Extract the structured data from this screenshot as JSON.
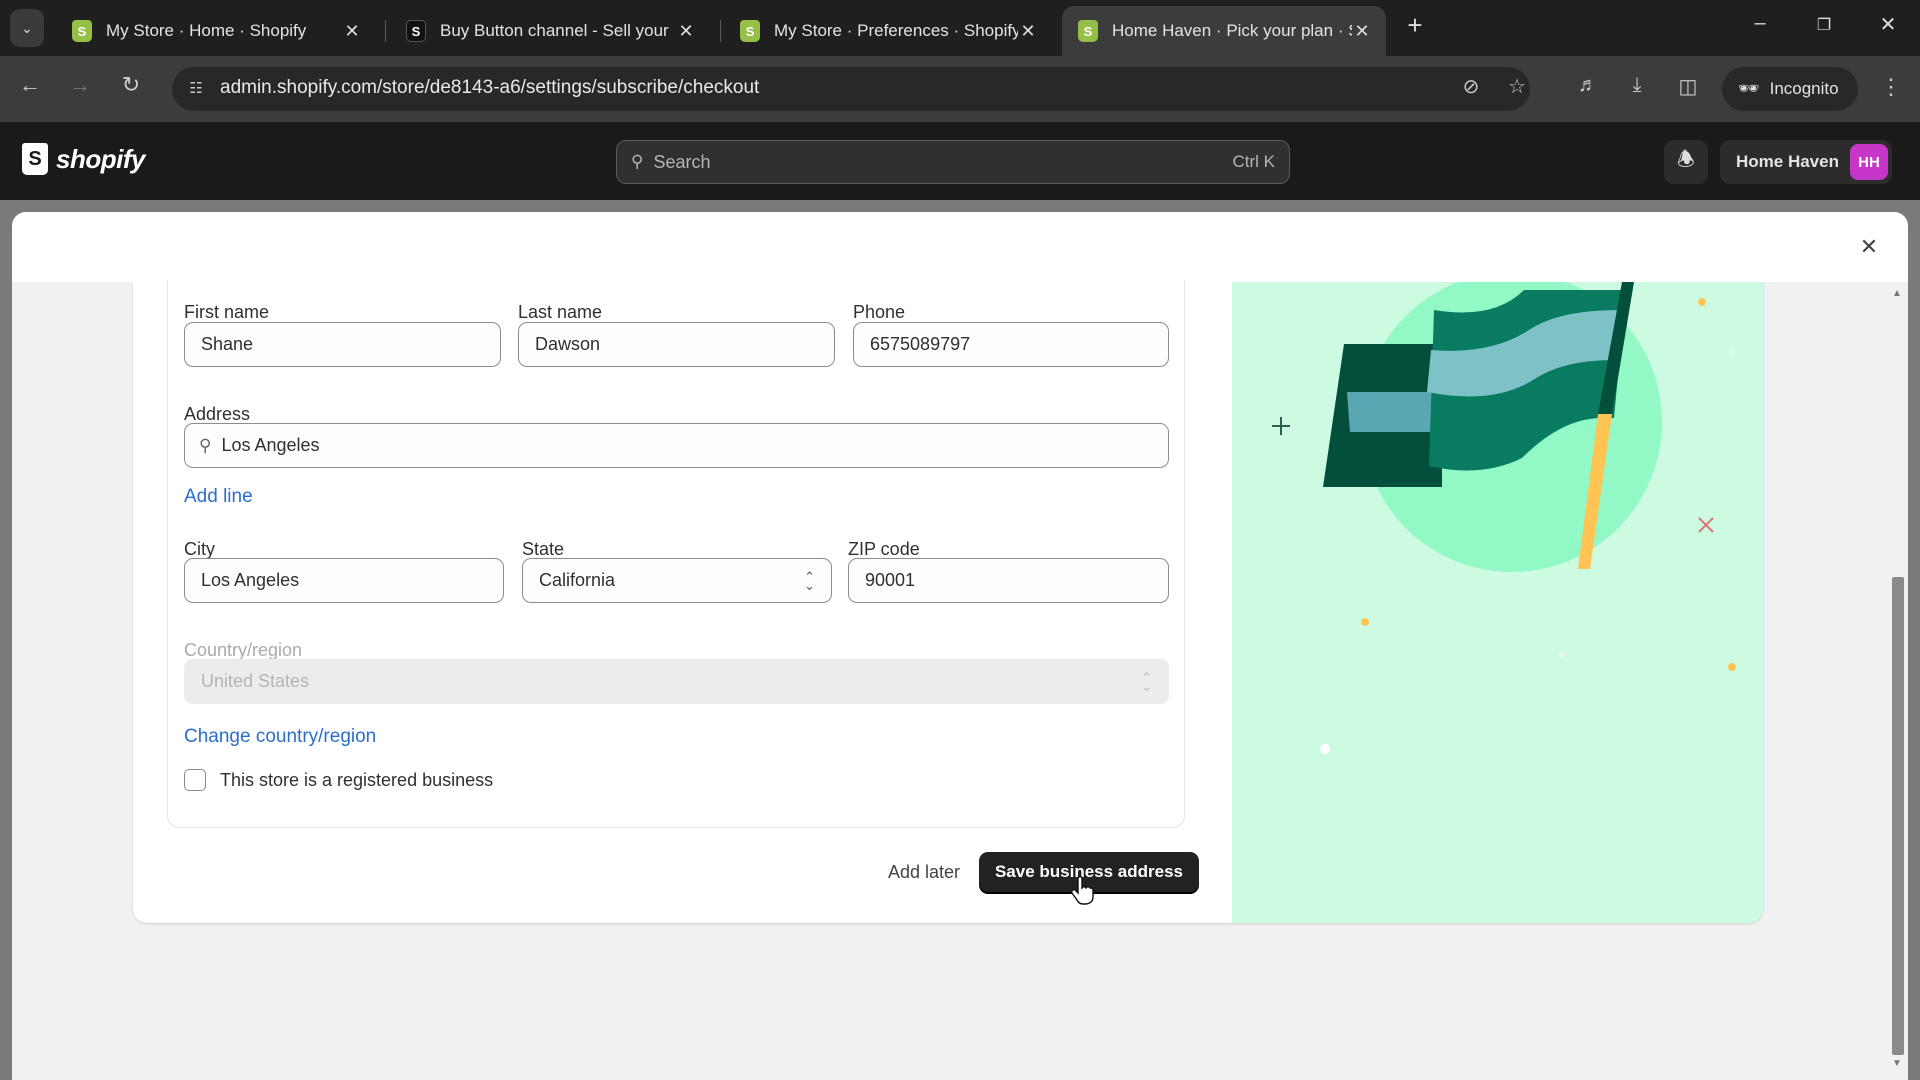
{
  "browser": {
    "tabs": [
      {
        "title": "My Store · Home · Shopify",
        "favicon": "shopify-icon",
        "active": false
      },
      {
        "title": "Buy Button channel - Sell your",
        "favicon": "buy-button-icon",
        "active": false
      },
      {
        "title": "My Store · Preferences · Shopify",
        "favicon": "shopify-icon",
        "active": false
      },
      {
        "title": "Home Haven · Pick your plan · S",
        "favicon": "shopify-icon",
        "active": true
      }
    ],
    "url": "admin.shopify.com/store/de8143-a6/settings/subscribe/checkout",
    "profile_label": "Incognito"
  },
  "topbar": {
    "brand": "shopify",
    "search_placeholder": "Search",
    "search_shortcut": "Ctrl K",
    "store_name": "Home Haven",
    "store_initials": "HH",
    "avatar_color": "#c536c9"
  },
  "form": {
    "first_name": {
      "label": "First name",
      "value": "Shane"
    },
    "last_name": {
      "label": "Last name",
      "value": "Dawson"
    },
    "phone": {
      "label": "Phone",
      "value": "6575089797"
    },
    "address": {
      "label": "Address",
      "value": "Los Angeles"
    },
    "add_line": "Add line",
    "city": {
      "label": "City",
      "value": "Los Angeles"
    },
    "state": {
      "label": "State",
      "value": "California"
    },
    "zip": {
      "label": "ZIP code",
      "value": "90001"
    },
    "country": {
      "label": "Country/region",
      "value": "United States",
      "disabled": true
    },
    "change_country": "Change country/region",
    "registered_business": {
      "label": "This store is a registered business",
      "checked": false
    }
  },
  "actions": {
    "add_later": "Add later",
    "save": "Save business address"
  },
  "colors": {
    "link": "#2c6ecb",
    "primary_button": "#222222",
    "illustration_bg": "#cdfbe2"
  }
}
